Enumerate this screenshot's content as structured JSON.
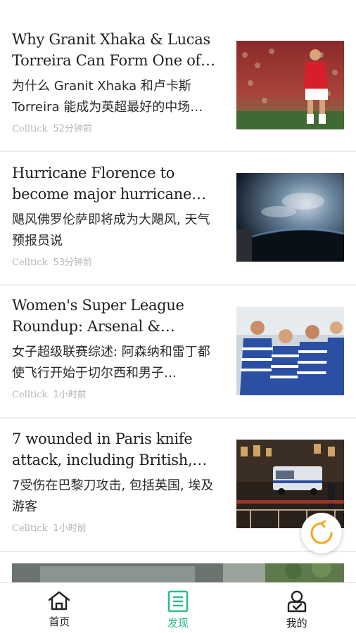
{
  "articles": [
    {
      "en_title": "Why Granit Xhaka & Lucas Torreira Can Form One of t…",
      "zh_title": "为什么 Granit Xhaka 和卢卡斯 Torreira 能成为英超最好的中场…",
      "source": "Celltick",
      "time": "52分钟前",
      "thumb": "football-player-photo"
    },
    {
      "en_title": "Hurricane Florence to become major hurricane soon,…",
      "zh_title": "飓风佛罗伦萨即将成为大飓风, 天气预报员说",
      "source": "Celltick",
      "time": "53分钟前",
      "thumb": "hurricane-satellite-photo"
    },
    {
      "en_title": "Women's Super League Roundup: Arsenal & Readin…",
      "zh_title": "女子超级联赛综述: 阿森纳和雷丁都使飞行开始于切尔西和男子…",
      "source": "Celltick",
      "time": "1小时前",
      "thumb": "womens-football-team-photo"
    },
    {
      "en_title": "7 wounded in Paris knife attack, including British,…",
      "zh_title": "7受伤在巴黎刀攻击, 包括英国, 埃及游客",
      "source": "Celltick",
      "time": "1小时前",
      "thumb": "paris-police-scene-photo"
    }
  ],
  "refresh_icon": "refresh-icon",
  "tabs": [
    {
      "label": "首页",
      "icon": "home-icon",
      "active": false
    },
    {
      "label": "发现",
      "icon": "discover-icon",
      "active": true
    },
    {
      "label": "我的",
      "icon": "profile-icon",
      "active": false
    }
  ],
  "colors": {
    "accent": "#2dbb8b",
    "refresh": "#f5a623"
  }
}
